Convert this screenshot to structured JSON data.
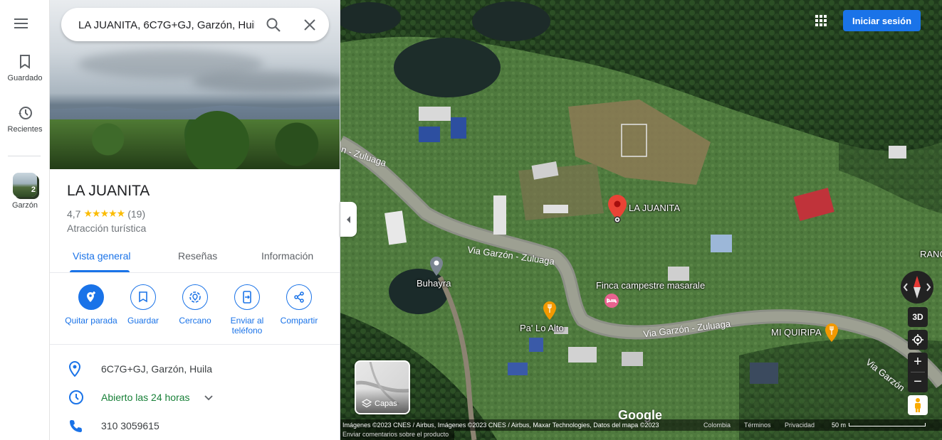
{
  "rail": {
    "saved_label": "Guardado",
    "recent_label": "Recientes",
    "recent_place_label": "Garzón",
    "recent_place_count": "2"
  },
  "search": {
    "value": "LA JUANITA, 6C7G+GJ, Garzón, Huila"
  },
  "place": {
    "name": "LA JUANITA",
    "rating": "4,7",
    "stars": "★★★★★",
    "review_count": "(19)",
    "category": "Atracción turística"
  },
  "tabs": [
    {
      "label": "Vista general"
    },
    {
      "label": "Reseñas"
    },
    {
      "label": "Información"
    }
  ],
  "actions": [
    {
      "label": "Quitar parada",
      "icon": "add-stop-icon"
    },
    {
      "label": "Guardar",
      "icon": "bookmark-icon"
    },
    {
      "label": "Cercano",
      "icon": "nearby-icon"
    },
    {
      "label": "Enviar al teléfono",
      "icon": "send-to-phone-icon"
    },
    {
      "label": "Compartir",
      "icon": "share-icon"
    }
  ],
  "info": {
    "address": "6C7G+GJ, Garzón, Huila",
    "hours": "Abierto las 24 horas",
    "phone": "310 3059615"
  },
  "map": {
    "pin_label": "LA JUANITA",
    "places": [
      {
        "name": "Buhayra"
      },
      {
        "name": "Finca campestre masarale"
      },
      {
        "name": "Pa' Lo Alto"
      },
      {
        "name": "MI QUIRIPA"
      },
      {
        "name": "RANC"
      }
    ],
    "roads": {
      "road_1": "Via Garzón - Zuluaga",
      "road_2": "Via Garzón - Zuluaga",
      "road_3": "Via Garzón",
      "road_4": "n - Zuluaga"
    },
    "signin_label": "Iniciar sesión",
    "layers_label": "Capas",
    "btn_3d": "3D",
    "google": "Google",
    "footer": {
      "attribution": "Imágenes ©2023 CNES / Airbus, Imágenes ©2023 CNES / Airbus, Maxar Technologies, Datos del mapa ©2023",
      "country": "Colombia",
      "terms": "Términos",
      "privacy": "Privacidad",
      "scale": "50 m",
      "feedback": "Enviar comentarios sobre el producto"
    },
    "colors": {
      "pin": "#ea4335",
      "accent": "#1a73e8",
      "food": "#f29900",
      "lodging": "#e8638f"
    }
  }
}
